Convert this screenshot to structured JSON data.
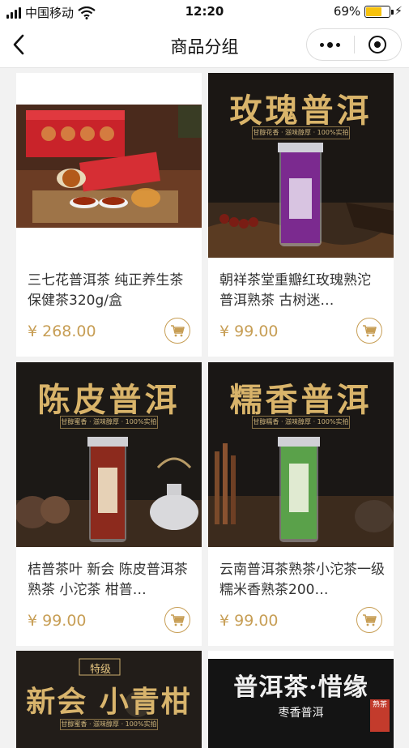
{
  "status": {
    "carrier": "中国移动",
    "time": "12:20",
    "battery": "69%",
    "battery_level": 0.69
  },
  "nav": {
    "title": "商品分组"
  },
  "products": [
    {
      "title": "三七花普洱茶 纯正养生茶 保健茶320g/盒",
      "price": "¥ 268.00"
    },
    {
      "title": "朝祥茶堂重瓣红玫瑰熟沱 普洱熟茶 古树迷…",
      "price": "¥ 99.00",
      "poster_title": "玫瑰普洱",
      "poster_sub": "甘醇花香 · 滋味醇厚 · 100%实拍"
    },
    {
      "title": "桔普茶叶 新会 陈皮普洱茶熟茶 小沱茶 柑普…",
      "price": "¥ 99.00",
      "poster_title": "陈皮普洱",
      "poster_sub": "甘醇蜜香 · 滋味醇厚 · 100%实拍"
    },
    {
      "title": "云南普洱茶熟茶小沱茶一级糯米香熟茶200…",
      "price": "¥ 99.00",
      "poster_title": "糯香普洱",
      "poster_sub": "甘醇糯香 · 滋味醇厚 · 100%实拍"
    },
    {
      "poster_title": "新会 小青柑",
      "poster_badge": "特级",
      "poster_sub": "甘醇蜜香 · 滋味醇厚 · 100%实拍"
    },
    {
      "poster_title": "普洱茶·惜缘",
      "poster_sub": "枣香普洱",
      "poster_badge": "熟茶"
    }
  ],
  "colors": {
    "price": "#c79e55",
    "poster_gold": "#d9b46a",
    "battery": "#f7c20c"
  }
}
